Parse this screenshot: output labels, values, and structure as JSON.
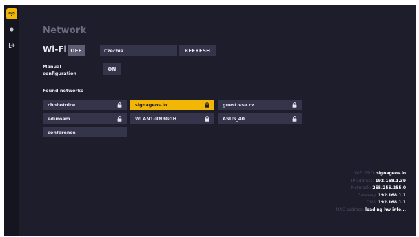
{
  "sidebar": {
    "items": [
      {
        "icon": "wifi-icon",
        "active": true
      },
      {
        "icon": "dot-icon",
        "active": false
      },
      {
        "icon": "logout-icon",
        "active": false
      }
    ]
  },
  "page": {
    "title": "Network"
  },
  "wifi": {
    "label": "Wi-Fi",
    "toggle_label": "OFF",
    "country": "Czechia",
    "refresh_label": "REFRESH"
  },
  "manual_config": {
    "label_line1": "Manual",
    "label_line2": "configuration",
    "toggle_label": "ON"
  },
  "networks": {
    "heading": "Found networks",
    "items": [
      {
        "ssid": "chobotnice",
        "locked": true,
        "selected": false
      },
      {
        "ssid": "signageos.io",
        "locked": true,
        "selected": true
      },
      {
        "ssid": "guest.vse.cz",
        "locked": true,
        "selected": false
      },
      {
        "ssid": "eduroam",
        "locked": true,
        "selected": false
      },
      {
        "ssid": "WLAN1-RN9GGH",
        "locked": true,
        "selected": false
      },
      {
        "ssid": "ASUS_40",
        "locked": true,
        "selected": false
      },
      {
        "ssid": "conference",
        "locked": false,
        "selected": false
      }
    ]
  },
  "info": {
    "wifi_ssid_label": "WiFi SSID:",
    "wifi_ssid": "signageos.io",
    "ip_label": "IP address:",
    "ip": "192.168.1.39",
    "netmask_label": "Netmask:",
    "netmask": "255.255.255.0",
    "gateway_label": "Gateway:",
    "gateway": "192.168.1.1",
    "dns_label": "DNS:",
    "dns": "192.168.1.1",
    "mac_label": "MAC address:",
    "mac": "loading hw info..."
  },
  "colors": {
    "background": "#1d1d2c",
    "sidebar": "#15151f",
    "accent": "#f2b705",
    "button": "#34344a",
    "muted": "#6a6a80"
  }
}
